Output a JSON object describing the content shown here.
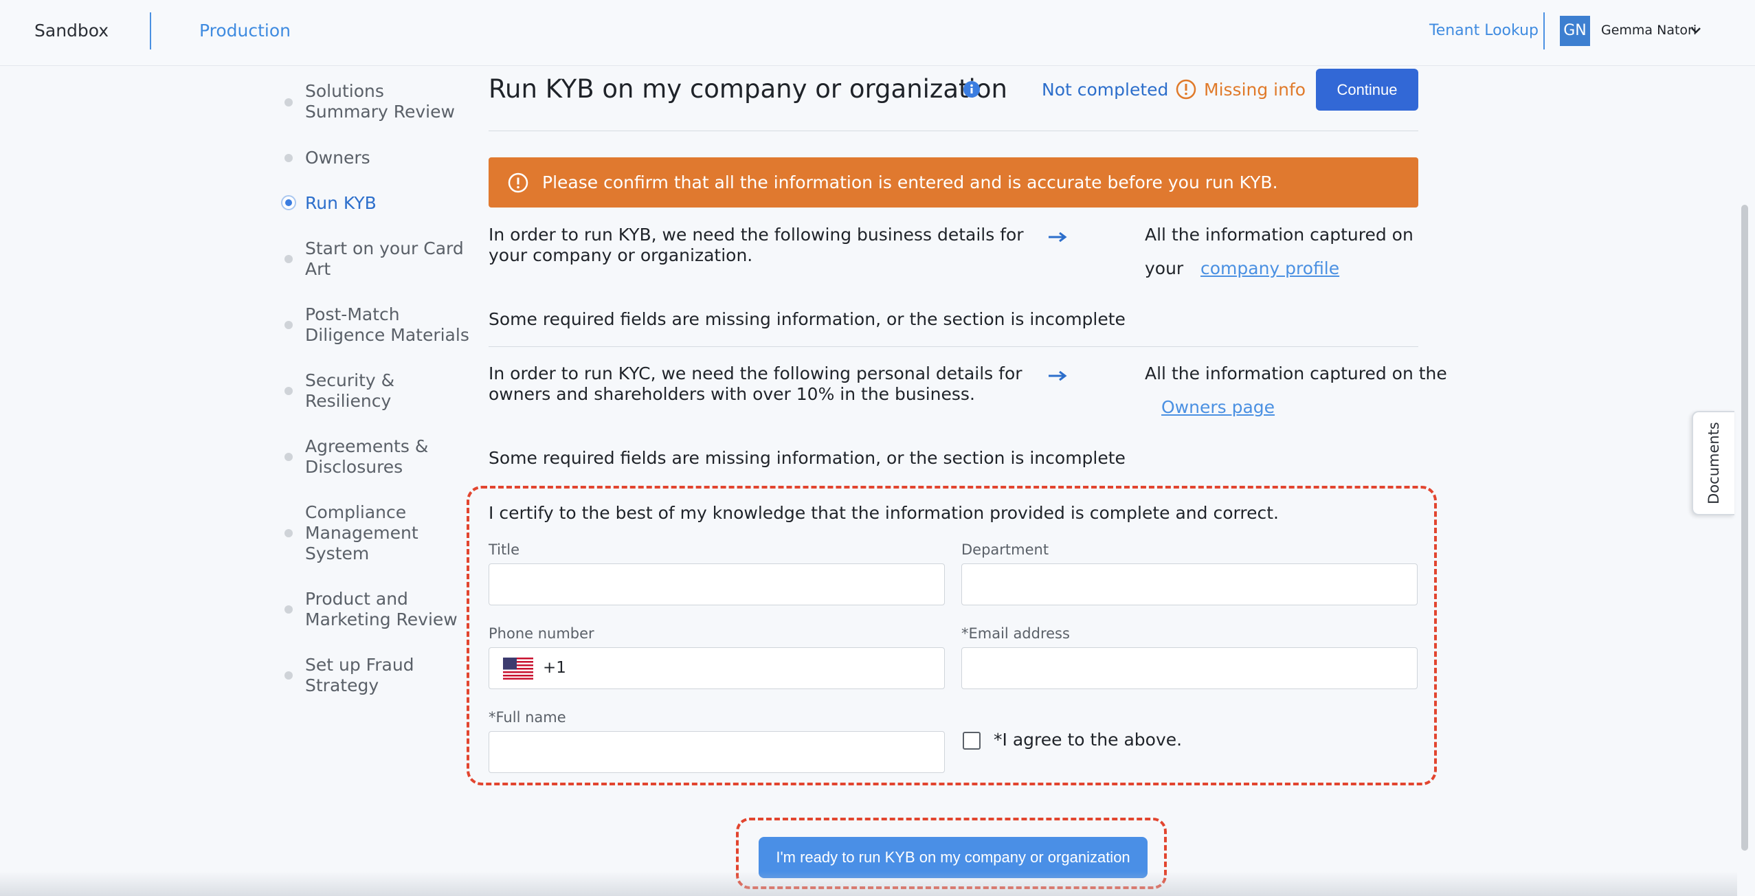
{
  "header": {
    "env_sandbox": "Sandbox",
    "env_production": "Production",
    "tenant_lookup": "Tenant Lookup",
    "avatar_initials": "GN",
    "user_name": "Gemma Natori"
  },
  "sidebar": {
    "items": [
      {
        "label": "Solutions Summary Review"
      },
      {
        "label": "Owners"
      },
      {
        "label": "Run KYB",
        "active": true
      },
      {
        "label": "Start on your Card Art"
      },
      {
        "label": "Post-Match Diligence Materials"
      },
      {
        "label": "Security & Resiliency"
      },
      {
        "label": "Agreements & Disclosures"
      },
      {
        "label": "Compliance Management System"
      },
      {
        "label": "Product and Marketing Review"
      },
      {
        "label": "Set up Fraud Strategy"
      }
    ]
  },
  "main": {
    "title": "Run KYB on my company or organization",
    "status": "Not completed",
    "missing_info": "Missing info",
    "continue_label": "Continue",
    "alert": "Please confirm that all the information is entered and is accurate before you run KYB.",
    "kyb": {
      "requirement": "In order to run KYB, we need the following business details for your company or organization.",
      "captured_prefix": "All the information captured on",
      "captured_prefix2": "your",
      "link": "company profile",
      "missing": "Some required fields are missing information, or the section is incomplete"
    },
    "kyc": {
      "requirement": "In order to run KYC, we need the following personal details for owners and shareholders with over 10% in the business.",
      "captured_prefix": "All the information captured on the",
      "link": "Owners page",
      "missing": "Some required fields are missing information, or the section is incomplete"
    },
    "certify": {
      "statement": "I certify to the best of my knowledge that the information provided is complete and correct.",
      "title_label": "Title",
      "title_value": "",
      "department_label": "Department",
      "department_value": "",
      "phone_label": "Phone number",
      "phone_code": "+1",
      "email_label": "*Email address",
      "email_value": "",
      "fullname_label": "*Full name",
      "fullname_value": "",
      "agree_label": "*I agree to the above.",
      "agree_checked": false
    },
    "run_button": "I'm ready to run KYB on my company or organization"
  },
  "documents_tab": "Documents",
  "colors": {
    "primary": "#3268d6",
    "link": "#4a90e2",
    "warning": "#e0792f",
    "highlight": "#e2452f"
  }
}
